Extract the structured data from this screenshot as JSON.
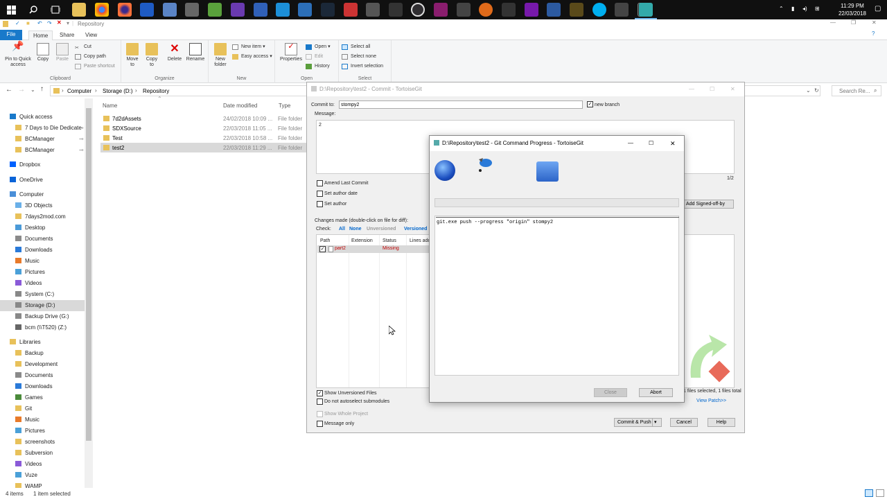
{
  "taskbar": {
    "icons": [
      "windows-start-icon",
      "search-icon",
      "task-view-icon",
      "file-explorer-icon",
      "chrome-icon",
      "firefox-icon",
      "app-icon",
      "thunderbird-icon",
      "calculator-icon",
      "notepad-icon",
      "visual-studio-icon",
      "app-icon",
      "app-icon",
      "app-icon",
      "steam-icon",
      "app-icon",
      "app-icon",
      "app-icon",
      "obs-icon",
      "vs-code-icon",
      "tools-icon",
      "app-icon",
      "app-icon",
      "onenote-icon",
      "app-icon",
      "app-icon",
      "skype-icon",
      "app-icon",
      "app-icon",
      "tortoisegit-icon"
    ],
    "clock_time": "11:29 PM",
    "clock_date": "22/03/2018"
  },
  "explorer": {
    "qat_title": "Repository",
    "tabs": [
      "File",
      "Home",
      "Share",
      "View"
    ],
    "ribbon": {
      "clipboard": {
        "pin": "Pin to Quick access",
        "copy": "Copy",
        "paste": "Paste",
        "cut": "Cut",
        "copy_path": "Copy path",
        "paste_shortcut": "Paste shortcut",
        "label": "Clipboard"
      },
      "organize": {
        "move_to": "Move to",
        "copy_to": "Copy to",
        "delete": "Delete",
        "rename": "Rename",
        "label": "Organize"
      },
      "new": {
        "new_folder": "New folder",
        "new_item": "New item",
        "easy_access": "Easy access",
        "label": "New"
      },
      "open": {
        "properties": "Properties",
        "open": "Open",
        "edit": "Edit",
        "history": "History",
        "label": "Open"
      },
      "select": {
        "select_all": "Select all",
        "select_none": "Select none",
        "invert": "Invert selection",
        "label": "Select"
      }
    },
    "breadcrumb": [
      "Computer",
      "Storage (D:)",
      "Repository"
    ],
    "search_placeholder": "Search Re...",
    "nav": [
      {
        "label": "Quick access"
      },
      {
        "label": "7 Days to Die Dedicate"
      },
      {
        "label": "BCManager"
      },
      {
        "label": "BCManager"
      },
      {
        "label": "Dropbox"
      },
      {
        "label": "OneDrive"
      },
      {
        "label": "Computer"
      },
      {
        "label": "3D Objects"
      },
      {
        "label": "7days2mod.com"
      },
      {
        "label": "Desktop"
      },
      {
        "label": "Documents"
      },
      {
        "label": "Downloads"
      },
      {
        "label": "Music"
      },
      {
        "label": "Pictures"
      },
      {
        "label": "Videos"
      },
      {
        "label": "System (C:)"
      },
      {
        "label": "Storage (D:)"
      },
      {
        "label": "Backup Drive (G:)"
      },
      {
        "label": "bcm (\\\\T520) (Z:)"
      },
      {
        "label": "Libraries"
      },
      {
        "label": "Backup"
      },
      {
        "label": "Development"
      },
      {
        "label": "Documents"
      },
      {
        "label": "Downloads"
      },
      {
        "label": "Games"
      },
      {
        "label": "Git"
      },
      {
        "label": "Music"
      },
      {
        "label": "Pictures"
      },
      {
        "label": "screenshots"
      },
      {
        "label": "Subversion"
      },
      {
        "label": "Videos"
      },
      {
        "label": "Vuze"
      },
      {
        "label": "WAMP"
      }
    ],
    "columns": {
      "name": "Name",
      "date": "Date modified",
      "type": "Type"
    },
    "files": [
      {
        "name": "7d2dAssets",
        "date": "24/02/2018 10:09 ...",
        "type": "File folder"
      },
      {
        "name": "SDXSource",
        "date": "22/03/2018 11:05 ...",
        "type": "File folder"
      },
      {
        "name": "Test",
        "date": "22/03/2018 10:58 ...",
        "type": "File folder"
      },
      {
        "name": "test2",
        "date": "22/03/2018 11:29 ...",
        "type": "File folder"
      }
    ],
    "status_items": "4 items",
    "status_selected": "1 item selected"
  },
  "commit": {
    "title": "D:\\Repository\\test2 - Commit - TortoiseGit",
    "commit_to_label": "Commit to:",
    "branch": "stompy2",
    "new_branch": "new branch",
    "message_label": "Message:",
    "message": "2",
    "counter": "1/2",
    "amend": "Amend Last Commit",
    "set_author_date": "Set author date",
    "set_author": "Set author",
    "add_signed_off": "Add Signed-off-by",
    "changes_label": "Changes made (double-click on file for diff):",
    "check_label": "Check:",
    "check_all": "All",
    "check_none": "None",
    "check_unversioned": "Unversioned",
    "check_versioned": "Versioned",
    "columns": [
      "Path",
      "Extension",
      "Status",
      "Lines add"
    ],
    "file_row": {
      "path": "part2",
      "extension": "",
      "status": "Missing"
    },
    "show_unversioned": "Show Unversioned Files",
    "no_autoselect": "Do not autoselect submodules",
    "show_whole_project": "Show Whole Project",
    "message_only": "Message only",
    "selected_info": "1 files selected, 1 files total",
    "view_patch": "View Patch>>",
    "commit_push": "Commit & Push",
    "cancel": "Cancel",
    "help": "Help"
  },
  "progress": {
    "title": "D:\\Repository\\test2 - Git Command Progress - TortoiseGit",
    "command": "git.exe push --progress \"origin\" stompy2",
    "close": "Close",
    "abort": "Abort",
    "progress_value": 0
  },
  "colors": {
    "accent": "#1979ca",
    "missing": "#c00000",
    "link": "#0066cc",
    "selection": "#cce8ff"
  }
}
